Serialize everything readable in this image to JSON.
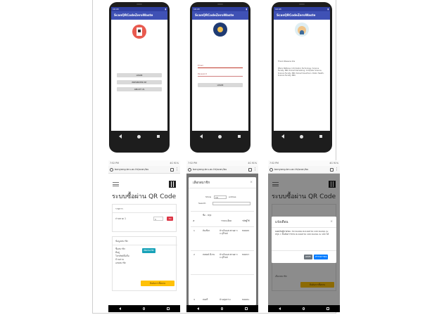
{
  "app": {
    "app_bar_title": "ScanQRCodeZeroWaste",
    "status_time": "10:43",
    "phone1": {
      "buttons": [
        "LOGIN",
        "PRESENTED BY",
        "ABOUT US"
      ]
    },
    "phone2": {
      "email_placeholder": "Email",
      "password_placeholder": "Password",
      "login_button": "LOGIN"
    },
    "phone3": {
      "heading": "Thank Wasaana kha",
      "body": "Pitsini Wattana: Information Technology, Science Faculty, BRU  Sirinart Kamaitong: Computer Science, Science Faculty, BRU  Sirinart Koamfunn: Public Health, Science Faculty, BRU"
    }
  },
  "web": {
    "status_left": "7:52 PM",
    "status_right": "4G 91%",
    "url": "banyang.bru.ac.th/scan/bu",
    "tab_count": "2",
    "site_title": "ระบบซื้อผ่าน QR Code",
    "screen1": {
      "card1_label": "รายการ",
      "item_label": "ถ่านขวด 1",
      "qty_value": "1",
      "del_label": "ลบ",
      "card2_label": "ข้อมูลสมาชิก",
      "member_lines": [
        "ชื่อสมาชิก",
        "ที่อยู่",
        "โทรศัพท์มือถือ",
        "บ้านสวน",
        "เลขสมาชิก"
      ],
      "choose_member_btn": "เลือกสมาชิก",
      "confirm_btn": "ยืนยันการซื้อขาย"
    },
    "screen2": {
      "modal_title": "เลือกสมาชิก",
      "close": "×",
      "show_label": "Show",
      "show_value": "10",
      "entries_label": "entries",
      "search_label": "Search:",
      "col_headers": [
        "#",
        "ชื่อ - สกุล",
        "รายละเอียด",
        "รหัสผู้ใช้"
      ],
      "rows": [
        {
          "no": "1",
          "name": "ส้มเขียว",
          "detail": "บ้านโนนสะพานยาว จ.บุรีรัมย์",
          "code": "M0065"
        },
        {
          "no": "2",
          "name": "สมพงษ์ ดีงาม",
          "detail": "บ้านโนนสะพานยาว จ.บุรีรัมย์",
          "code": "M0057"
        },
        {
          "no": "3",
          "name": "สมศรี",
          "detail": "บ้านทุ่งสว่าง",
          "code": "M0081"
        }
      ]
    },
    "screen3": {
      "modal_title": "แจ้งเตือน",
      "close": "×",
      "message": "ยอดเงินผู้ขายขยะ 30 คะแนน คะแนนรวม 100 คะแนน จะ สกุล = ยืนยันการขาย คะแนนรวม 100 คะแนน จะ แจ้ง ได้",
      "cancel_btn": "ยกเลิก",
      "ok_btn": "ทำรายการต่อ",
      "bg_label": "เลือกสมาชิก",
      "bg_btn": "ยืนยันการซื้อขาย"
    }
  }
}
